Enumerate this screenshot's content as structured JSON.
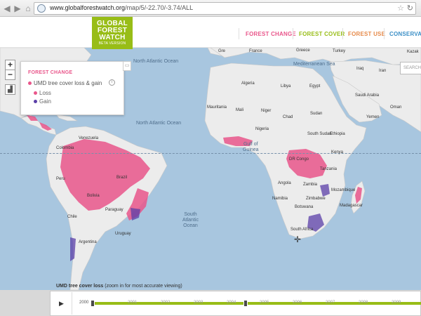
{
  "browser": {
    "url_host": "www.globalforestwatch.org",
    "url_path": "/map/5/-22.70/-3.74/ALL",
    "back_icon": "arrow-left-icon",
    "forward_icon": "arrow-right-icon"
  },
  "logo": {
    "line1": "GLOBAL",
    "line2": "FOREST",
    "line3": "WATCH",
    "line4": "BETA VERSION"
  },
  "topnav": {
    "forest_change": "FOREST CHANGE",
    "forest_cover": "FOREST COVER",
    "forest_use": "FOREST USE",
    "conservation": "CONSERVATIO"
  },
  "map": {
    "zoom_in": "+",
    "zoom_out": "−",
    "search_placeholder": "SEARCH",
    "oceans": {
      "north_atlantic_upper": "North\nAtlantic\nOcean",
      "north_atlantic_label": "North Atlantic Ocean",
      "south_atlantic": "South\nAtlantic\nOcean",
      "gulf_of_guinea": "Gulf of\nGuinea",
      "mediterranean": "Mediterranean Sea"
    },
    "countries": {
      "greenland": "Gre",
      "france": "France",
      "greece": "Greece",
      "turkey": "Turkey",
      "algeria": "Algeria",
      "libya": "Libya",
      "egypt": "Egypt",
      "iraq": "Iraq",
      "iran": "Iran",
      "saudi_arabia": "Saudi Arabia",
      "mauritania": "Mauritania",
      "mali": "Mali",
      "niger": "Niger",
      "chad": "Chad",
      "sudan": "Sudan",
      "south_sudan": "South Sudan",
      "ethiopia": "Ethiopia",
      "nigeria": "Nigeria",
      "yemen": "Yemen",
      "oman": "Oman",
      "kenya": "Kenya",
      "dr_congo": "DR Congo",
      "tanzania": "Tanzania",
      "angola": "Angola",
      "zambia": "Zambia",
      "mozambique": "Mozambique",
      "namibia": "Namibia",
      "botswana": "Botswana",
      "zimbabwe": "Zimbabwe",
      "madagascar": "Madagascar",
      "south_africa": "South Africa",
      "venezuela": "Venezuela",
      "colombia": "Colombia",
      "peru": "Peru",
      "brazil": "Brazil",
      "bolivia": "Bolivia",
      "paraguay": "Paraguay",
      "argentina": "Argentina",
      "chile": "Chile",
      "uruguay": "Uruguay",
      "kazakhstan": "Kazak"
    }
  },
  "legend": {
    "title": "FOREST CHANGE",
    "layer": "UMD tree cover loss & gain",
    "info_icon": "i",
    "loss": "Loss",
    "gain": "Gain",
    "loss_color": "#e9568b",
    "gain_color": "#5b3fa8"
  },
  "timeline": {
    "title": "UMD tree cover loss",
    "subtitle": "(zoom in for most accurate viewing)",
    "play": "▶",
    "years": [
      "2000",
      "2001",
      "2002",
      "2003",
      "2004",
      "2005",
      "2006",
      "2007",
      "2008",
      "2009",
      "2010"
    ]
  },
  "colors": {
    "brand_green": "#98bd17",
    "forest_change_pink": "#e9568b",
    "forest_use_orange": "#e68a4a",
    "conservation_blue": "#3b8fc6",
    "ocean": "#a8c6df",
    "land": "#ececec"
  }
}
